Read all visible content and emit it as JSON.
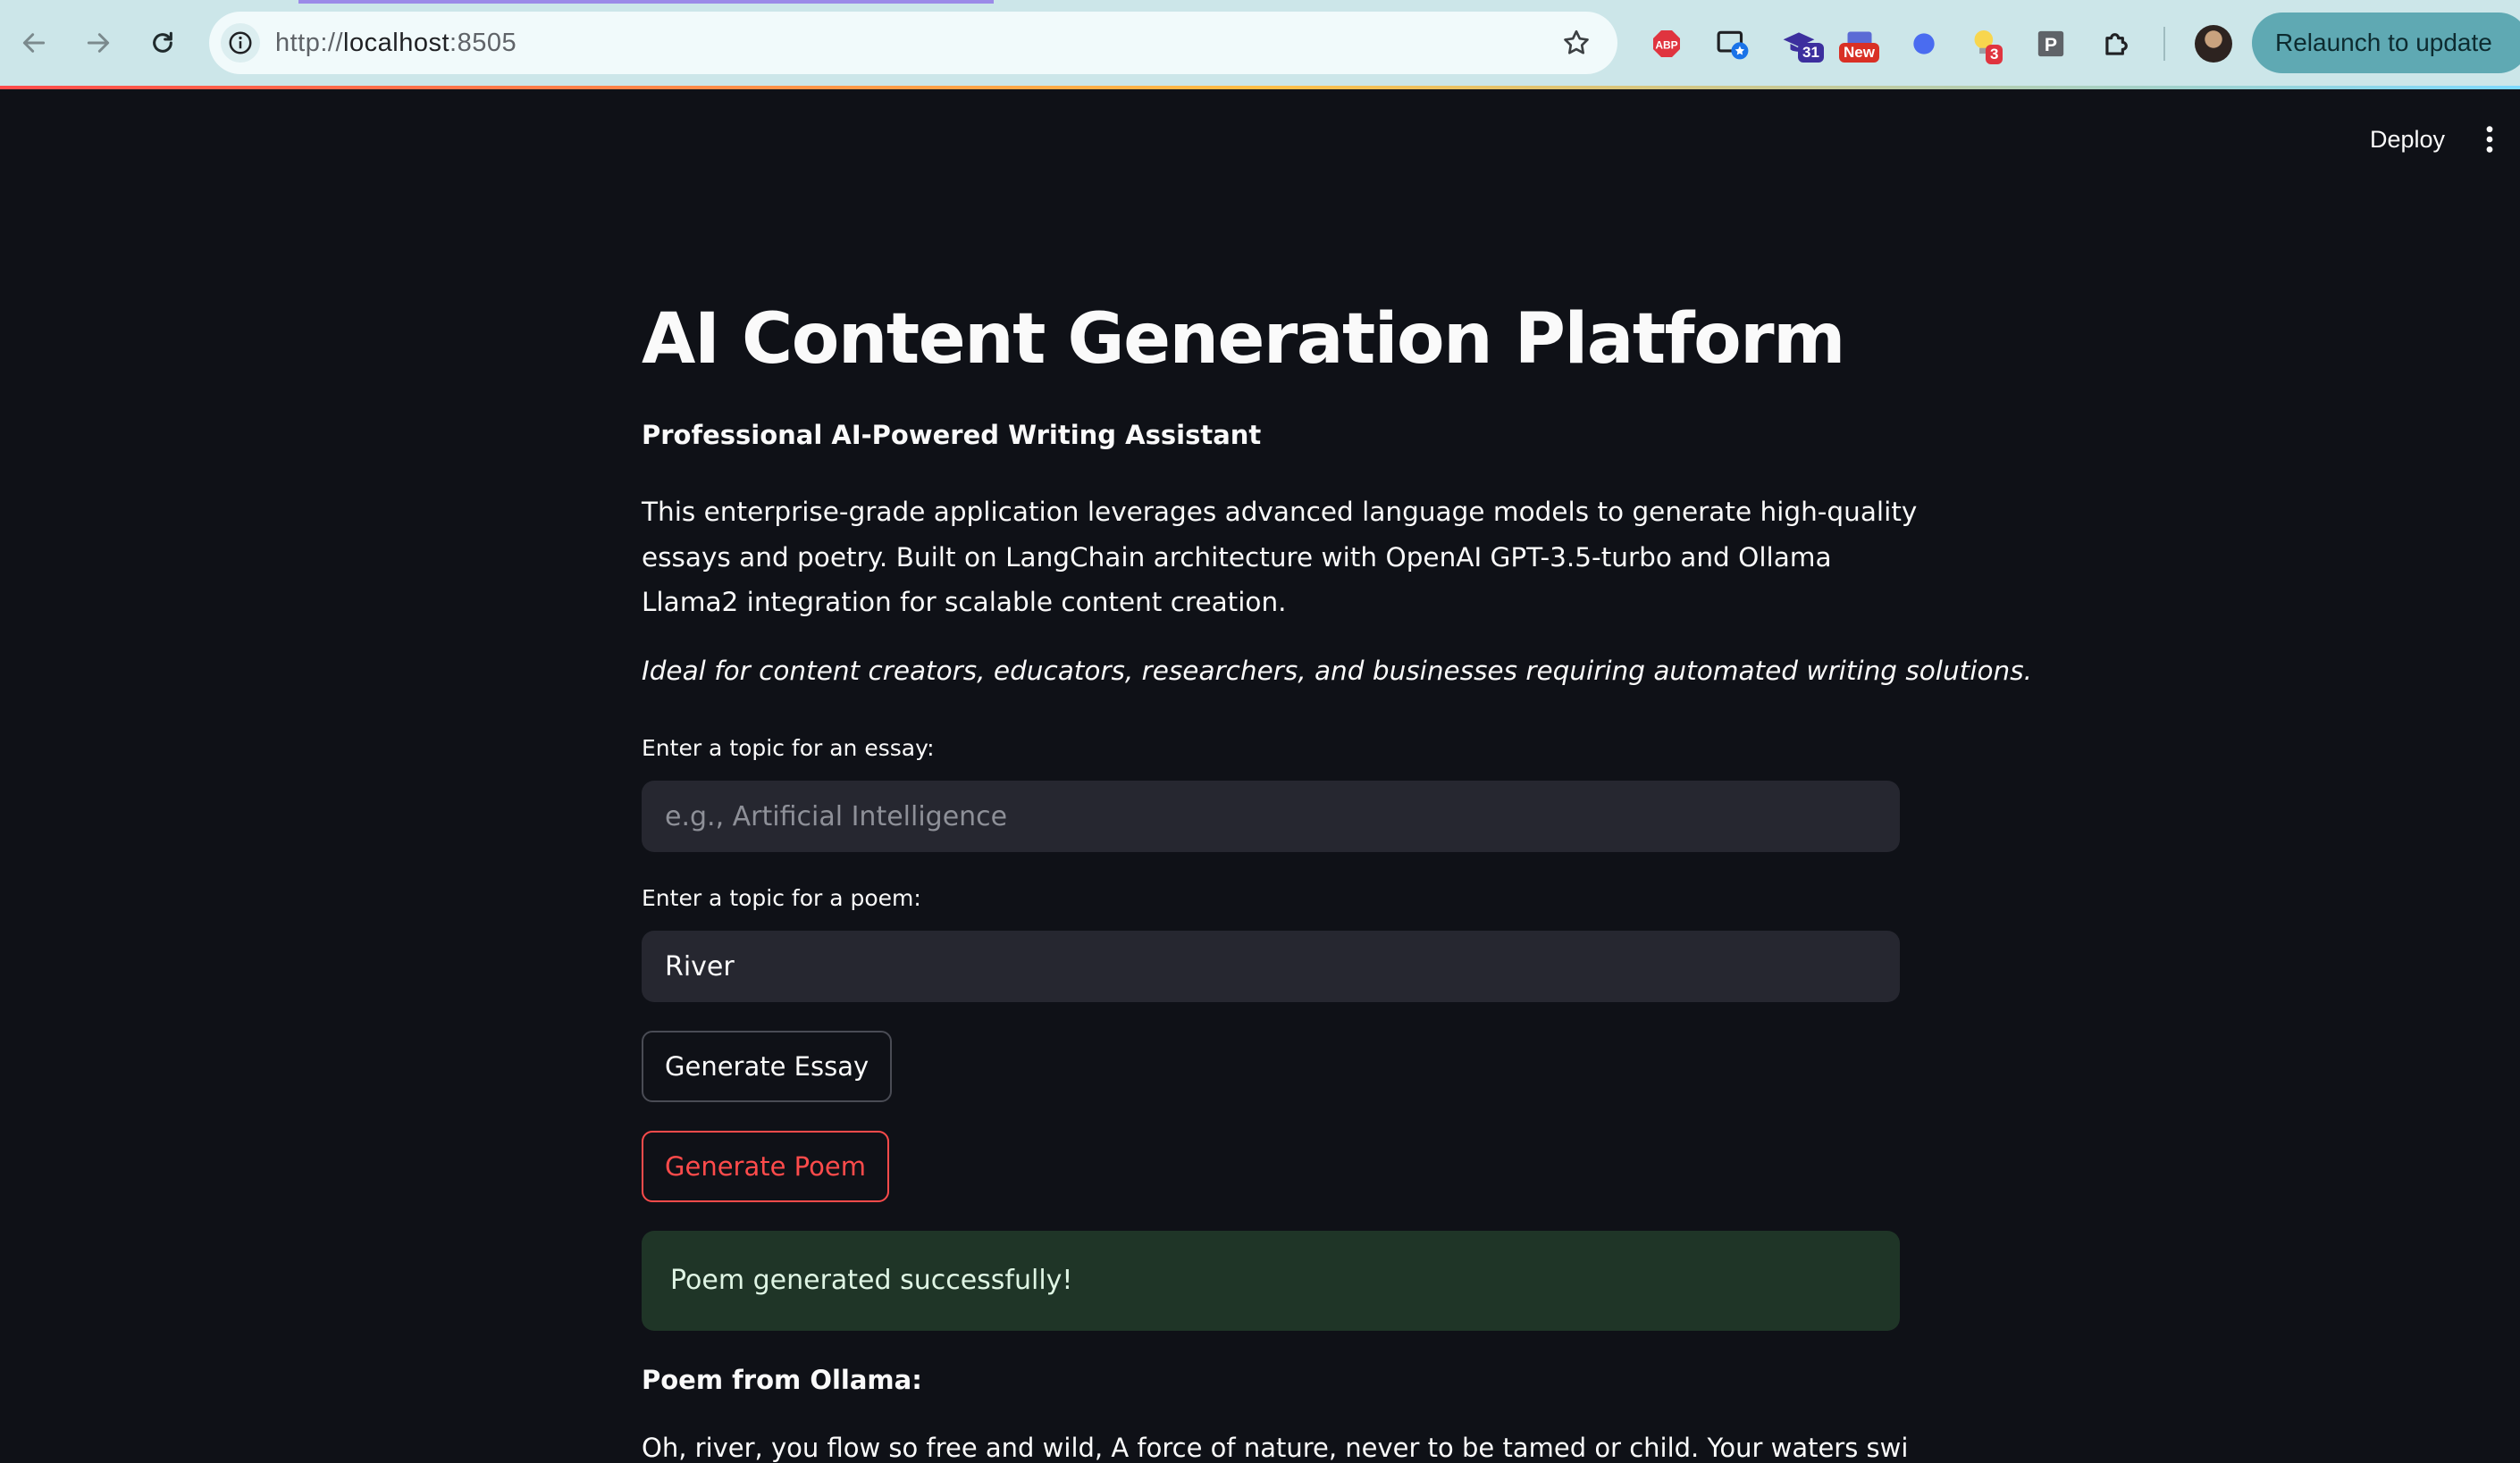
{
  "browser": {
    "url_prefix": "http://",
    "url_host": "localhost",
    "url_port": ":8505",
    "extensions": [
      {
        "name": "adblock-plus-icon",
        "label": "ABP",
        "color": "#e0343f"
      },
      {
        "name": "bookmark-tabs-icon",
        "label": "",
        "color": "#1a73e8"
      },
      {
        "name": "graduation-cap-icon",
        "label": "31",
        "color": "#3c2f9e"
      },
      {
        "name": "news-icon",
        "label": "New",
        "color": "#d93025"
      },
      {
        "name": "blue-dot-icon",
        "label": "",
        "color": "#4a6cf0"
      },
      {
        "name": "lightbulb-icon",
        "label": "3",
        "color": "#e0343f"
      },
      {
        "name": "p-extension-icon",
        "label": "P",
        "color": "#5f6368"
      }
    ],
    "relaunch_label": "Relaunch to update"
  },
  "header": {
    "deploy_label": "Deploy"
  },
  "main": {
    "title": "AI Content Generation Platform",
    "subtitle": "Professional AI-Powered Writing Assistant",
    "description": "This enterprise-grade application leverages advanced language models to generate high-quality essays and poetry. Built on LangChain architecture with OpenAI GPT-3.5-turbo and Ollama Llama2 integration for scalable content creation.",
    "tagline": "Ideal for content creators, educators, researchers, and businesses requiring automated writing solutions.",
    "essay_label": "Enter a topic for an essay:",
    "essay_placeholder": "e.g., Artificial Intelligence",
    "essay_value": "",
    "poem_label": "Enter a topic for a poem:",
    "poem_value": "River",
    "generate_essay_label": "Generate Essay",
    "generate_poem_label": "Generate Poem",
    "success_message": "Poem generated successfully!",
    "poem_heading": "Poem from Ollama:",
    "poem_text": "Oh, river, you flow so free and wild, A force of nature, never to be tamed or child. Your waters swirl and"
  },
  "colors": {
    "background": "#0f1117",
    "text": "#fafafa",
    "input_bg": "#262730",
    "primary": "#ff4b4b",
    "success_bg": "#1f3527"
  }
}
